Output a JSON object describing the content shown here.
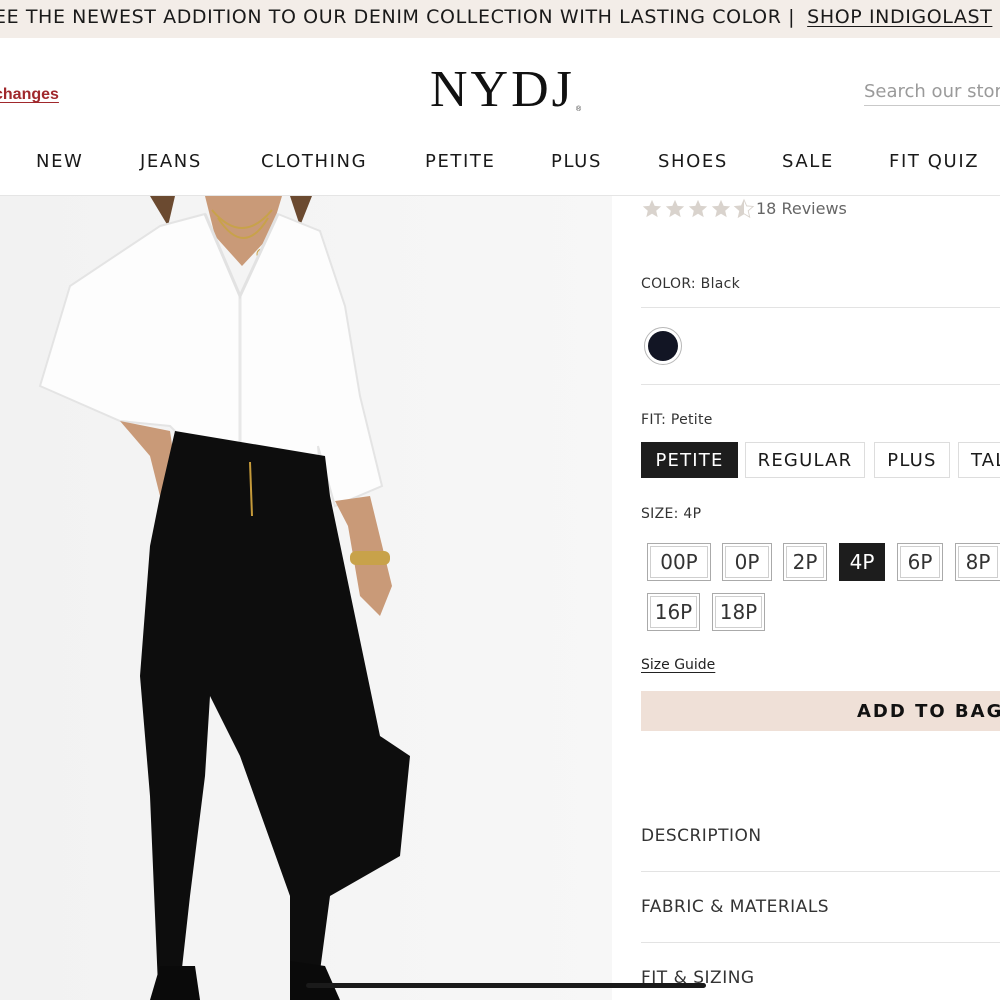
{
  "announcement": {
    "text": "EE THE NEWEST ADDITION TO OUR DENIM COLLECTION WITH LASTING COLOR |",
    "link": "SHOP INDIGOLAST"
  },
  "header": {
    "exchanges_link": "changes",
    "logo": "NYDJ",
    "logo_mark": "®",
    "search_placeholder": "Search our store"
  },
  "nav": {
    "items": [
      "NEW",
      "JEANS",
      "CLOTHING",
      "PETITE",
      "PLUS",
      "SHOES",
      "SALE",
      "FIT QUIZ"
    ]
  },
  "product": {
    "rating": 4.5,
    "rating_max": 5,
    "reviews": "18 Reviews",
    "color": {
      "label": "COLOR: Black",
      "swatch_color": "#121524"
    },
    "fit": {
      "label": "FIT: Petite",
      "options": [
        "PETITE",
        "REGULAR",
        "PLUS",
        "TALL"
      ],
      "selected": "PETITE"
    },
    "size": {
      "label": "SIZE: 4P",
      "options": [
        "00P",
        "0P",
        "2P",
        "4P",
        "6P",
        "8P",
        "16P",
        "18P"
      ],
      "selected": "4P"
    },
    "size_guide": "Size Guide",
    "add_to_bag": "ADD TO BAG",
    "accordions": [
      "DESCRIPTION",
      "FABRIC & MATERIALS",
      "FIT & SIZING"
    ]
  },
  "colors": {
    "announcement_bg": "#f3ede8",
    "exchanges_red": "#a0282c",
    "add_to_bag_bg": "#efe0d7",
    "selected_bg": "#1d1d1d",
    "jeans_black": "#0d0d0d"
  }
}
